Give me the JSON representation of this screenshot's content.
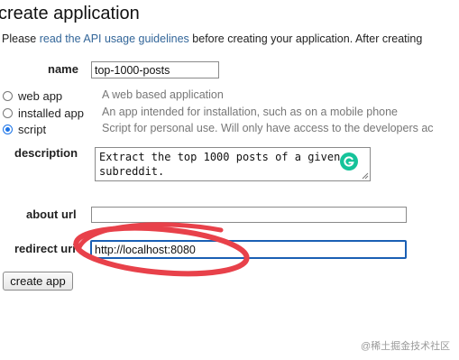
{
  "page": {
    "title": "create application",
    "intro_before": "Please ",
    "intro_link": "read the API usage guidelines",
    "intro_after": " before creating your application. After creating"
  },
  "form": {
    "name_label": "name",
    "name_value": "top-1000-posts",
    "app_types": [
      {
        "label": "web app",
        "description": "A web based application",
        "selected": false
      },
      {
        "label": "installed app",
        "description": "An app intended for installation, such as on a mobile phone",
        "selected": false
      },
      {
        "label": "script",
        "description": "Script for personal use. Will only have access to the developers ac",
        "selected": true
      }
    ],
    "description_label": "description",
    "description_value": "Extract the top 1000 posts of a given subreddit.",
    "about_url_label": "about url",
    "about_url_value": "",
    "redirect_uri_label": "redirect uri",
    "redirect_uri_value": "http://localhost:8080",
    "submit_label": "create app"
  },
  "overlay": {
    "grammarly_icon": "grammarly-icon",
    "annotation_color": "#e8414a",
    "watermark_text": "@稀土掘金技术社区"
  }
}
